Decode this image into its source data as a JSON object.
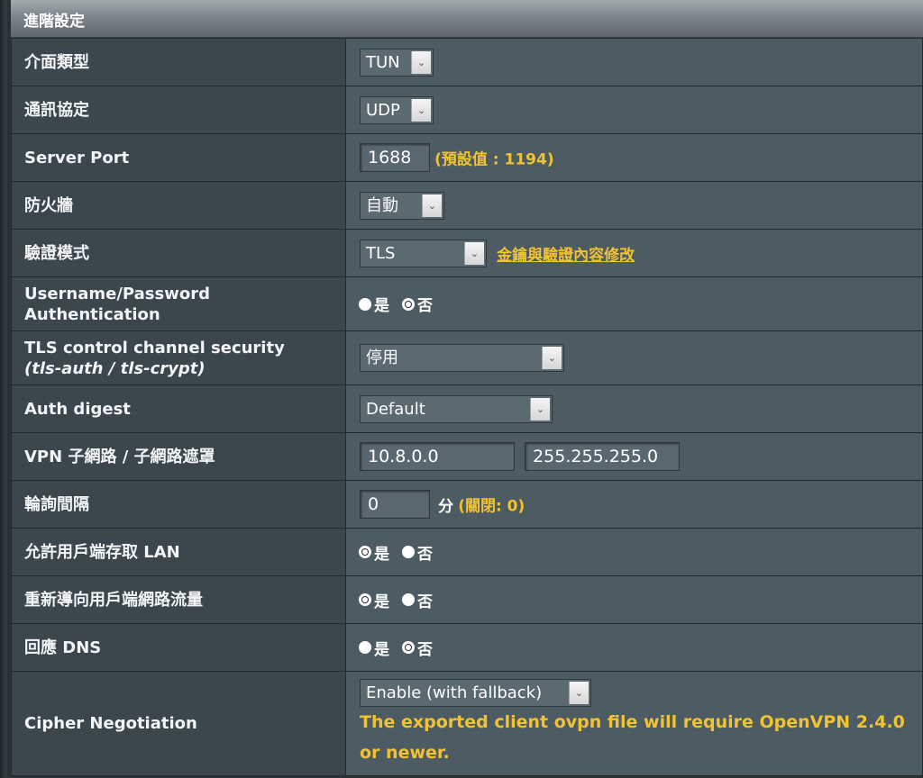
{
  "header": {
    "title": "進階設定"
  },
  "rows": {
    "interface": {
      "label": "介面類型",
      "value": "TUN"
    },
    "protocol": {
      "label": "通訊協定",
      "value": "UDP"
    },
    "server_port": {
      "label": "Server Port",
      "value": "1688",
      "hint": "(預設值 : 1194)"
    },
    "firewall": {
      "label": "防火牆",
      "value": "自動"
    },
    "auth_mode": {
      "label": "驗證模式",
      "value": "TLS",
      "link": "金鑰與驗證內容修改"
    },
    "userpass": {
      "label_line1": "Username/Password",
      "label_line2": "Authentication",
      "options": [
        "是",
        "否"
      ],
      "selected": "否"
    },
    "tls_control": {
      "label_line1": "TLS control channel security",
      "label_line2": "(tls-auth / tls-crypt)",
      "value": "停用"
    },
    "auth_digest": {
      "label": "Auth digest",
      "value": "Default"
    },
    "vpn_subnet": {
      "label": "VPN 子網路 / 子網路遮罩",
      "subnet": "10.8.0.0",
      "mask": "255.255.255.0"
    },
    "poll_interval": {
      "label": "輪詢間隔",
      "value": "0",
      "unit": "分",
      "hint": "(關閉: 0)"
    },
    "client_lan": {
      "label": "允許用戶端存取 LAN",
      "options": [
        "是",
        "否"
      ],
      "selected": "是"
    },
    "redirect": {
      "label": "重新導向用戶端網路流量",
      "options": [
        "是",
        "否"
      ],
      "selected": "是"
    },
    "respond_dns": {
      "label": "回應 DNS",
      "options": [
        "是",
        "否"
      ],
      "selected": "否"
    },
    "cipher": {
      "label": "Cipher Negotiation",
      "value": "Enable (with fallback)",
      "warning": "The exported client ovpn file will require OpenVPN 2.4.0 or newer."
    }
  }
}
